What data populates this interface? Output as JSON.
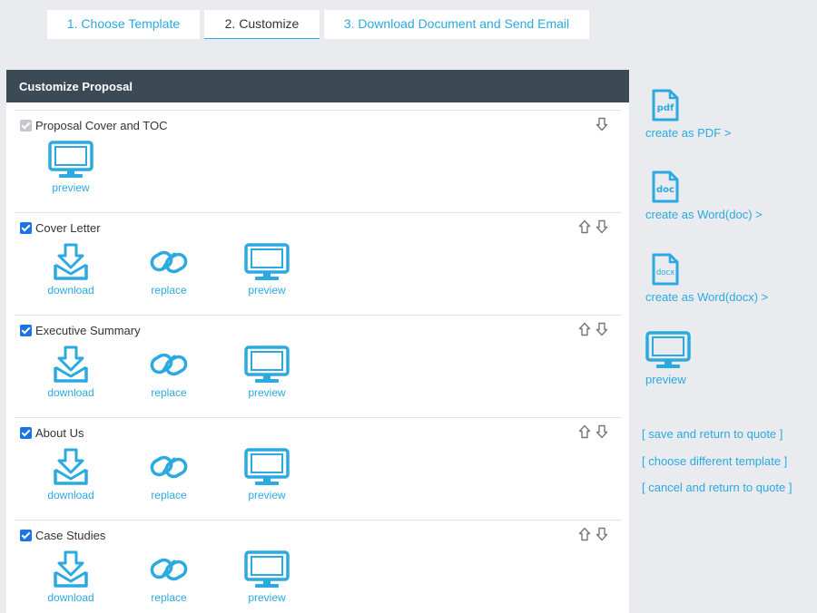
{
  "tabs": [
    {
      "label": "1. Choose Template"
    },
    {
      "label": "2. Customize"
    },
    {
      "label": "3. Download Document and Send Email"
    }
  ],
  "panel": {
    "title": "Customize Proposal",
    "sections": [
      {
        "title": "Proposal Cover and TOC",
        "checked": true,
        "disabled": true,
        "preview": "preview"
      },
      {
        "title": "Cover Letter",
        "checked": true,
        "download": "download",
        "replace": "replace",
        "preview": "preview"
      },
      {
        "title": "Executive Summary",
        "checked": true,
        "download": "download",
        "replace": "replace",
        "preview": "preview"
      },
      {
        "title": "About Us",
        "checked": true,
        "download": "download",
        "replace": "replace",
        "preview": "preview"
      },
      {
        "title": "Case Studies",
        "checked": true,
        "download": "download",
        "replace": "replace",
        "preview": "preview"
      }
    ]
  },
  "sidebar": {
    "pdf": {
      "icon_text": "pdf",
      "label": "create as PDF >"
    },
    "doc": {
      "icon_text": "doc",
      "label": "create as Word(doc) >"
    },
    "docx": {
      "icon_text": "docx",
      "label": "create as Word(docx) >"
    },
    "preview": "preview",
    "links": {
      "save": "[ save and return to quote ]",
      "choose": "[ choose different template ]",
      "cancel": "[ cancel and return to quote ]"
    }
  },
  "colors": {
    "accent": "#2ba9e1",
    "header": "#3c4a56",
    "background": "#e9ebee",
    "checkbox": "#1a73e8"
  }
}
